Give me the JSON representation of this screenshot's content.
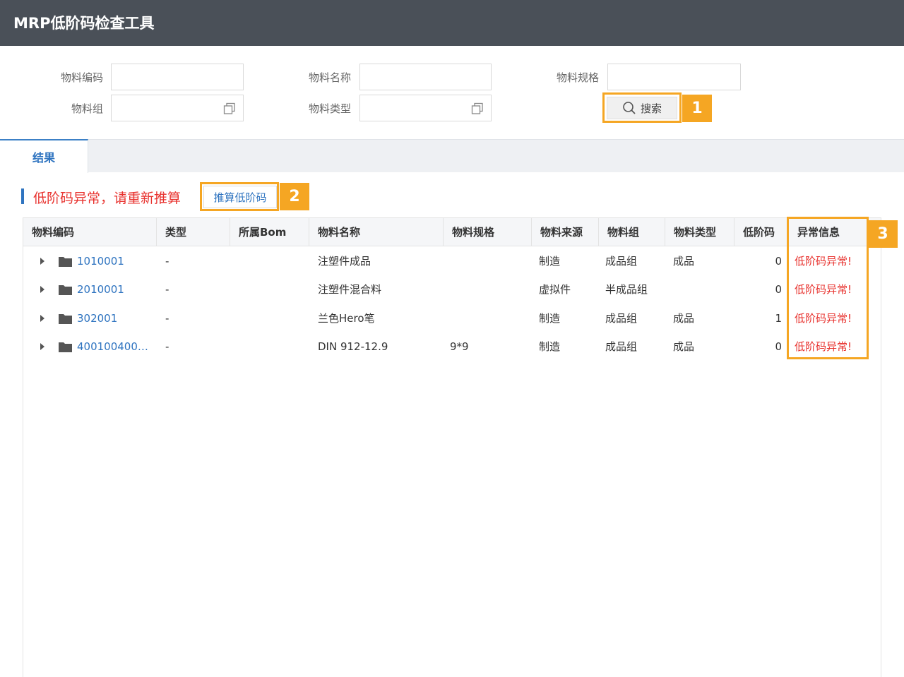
{
  "window": {
    "title": "MRP低阶码检查工具"
  },
  "filters": {
    "material_code": {
      "label": "物料编码",
      "value": ""
    },
    "material_name": {
      "label": "物料名称",
      "value": ""
    },
    "material_spec": {
      "label": "物料规格",
      "value": ""
    },
    "material_group": {
      "label": "物料组",
      "value": ""
    },
    "material_type": {
      "label": "物料类型",
      "value": ""
    },
    "search_label": "搜索"
  },
  "tabs": [
    {
      "label": "结果",
      "active": true
    }
  ],
  "alert": {
    "message": "低阶码异常，请重新推算",
    "action_label": "推算低阶码"
  },
  "annotations": {
    "badge1": "1",
    "badge2": "2",
    "badge3": "3",
    "highlight_color": "#f5a623"
  },
  "table": {
    "columns": [
      "物料编码",
      "类型",
      "所属Bom",
      "物料名称",
      "物料规格",
      "物料来源",
      "物料组",
      "物料类型",
      "低阶码",
      "异常信息"
    ],
    "rows": [
      {
        "code": "1010001",
        "type": "-",
        "bom": "",
        "name": "注塑件成品",
        "spec": "",
        "source": "制造",
        "group": "成品组",
        "mtype": "成品",
        "llc": "0",
        "error": "低阶码异常!"
      },
      {
        "code": "2010001",
        "type": "-",
        "bom": "",
        "name": "注塑件混合料",
        "spec": "",
        "source": "虚拟件",
        "group": "半成品组",
        "mtype": "",
        "llc": "0",
        "error": "低阶码异常!"
      },
      {
        "code": "302001",
        "type": "-",
        "bom": "",
        "name": "兰色Hero笔",
        "spec": "",
        "source": "制造",
        "group": "成品组",
        "mtype": "成品",
        "llc": "1",
        "error": "低阶码异常!"
      },
      {
        "code": "400100400…",
        "type": "-",
        "bom": "",
        "name": "DIN 912-12.9",
        "spec": "9*9",
        "source": "制造",
        "group": "成品组",
        "mtype": "成品",
        "llc": "0",
        "error": "低阶码异常!"
      }
    ]
  },
  "colors": {
    "titlebar": "#4a5058",
    "link": "#2f74c0",
    "error": "#e8322e"
  },
  "icons": {
    "search": "magnifier-icon",
    "picker": "window-picker-icon",
    "row_folder": "folder-icon",
    "row_expand": "caret-right-icon"
  }
}
